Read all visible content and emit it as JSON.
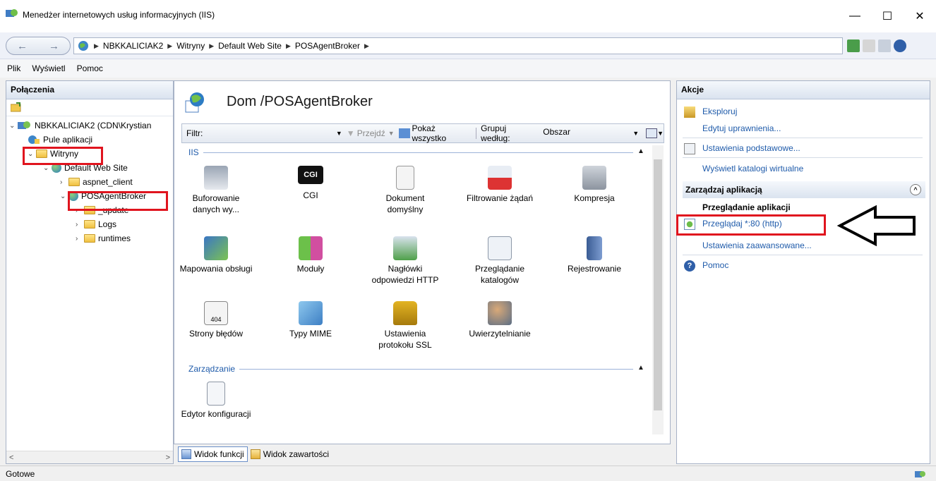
{
  "window": {
    "title": "Menedżer internetowych usług informacyjnych (IIS)",
    "minimize": "—",
    "maximize": "☐",
    "close": "✕"
  },
  "address": {
    "back": "←",
    "forward": "→",
    "crumbs": [
      "NBKKALICIAK2",
      "Witryny",
      "Default Web Site",
      "POSAgentBroker"
    ],
    "separator": "▶"
  },
  "menu": [
    "Plik",
    "Wyświetl",
    "Pomoc"
  ],
  "connections": {
    "header": "Połączenia",
    "tree": {
      "server": "NBKKALICIAK2 (CDN\\Krystian",
      "app_pools": "Pule aplikacji",
      "sites": "Witryny",
      "default_site": "Default Web Site",
      "aspnet_client": "aspnet_client",
      "pos": "POSAgentBroker",
      "update": "_update",
      "logs": "Logs",
      "runtimes": "runtimes"
    },
    "scroll_left": "<",
    "scroll_right": ">"
  },
  "center": {
    "title": "Dom /POSAgentBroker",
    "filter": {
      "label": "Filtr:",
      "go": "Przejdź",
      "show_all": "Pokaż wszystko",
      "group_by": "Grupuj według:",
      "group_value": "Obszar"
    },
    "sections": {
      "iis": "IIS",
      "management": "Zarządzanie"
    },
    "features": [
      {
        "l1": "Buforowanie",
        "l2": "danych wy..."
      },
      {
        "l1": "CGI",
        "l2": ""
      },
      {
        "l1": "Dokument",
        "l2": "domyślny"
      },
      {
        "l1": "Filtrowanie żądań",
        "l2": ""
      },
      {
        "l1": "Kompresja",
        "l2": ""
      },
      {
        "l1": "Mapowania obsługi",
        "l2": ""
      },
      {
        "l1": "Moduły",
        "l2": ""
      },
      {
        "l1": "Nagłówki",
        "l2": "odpowiedzi HTTP"
      },
      {
        "l1": "Przeglądanie",
        "l2": "katalogów"
      },
      {
        "l1": "Rejestrowanie",
        "l2": ""
      },
      {
        "l1": "Strony błędów",
        "l2": ""
      },
      {
        "l1": "Typy MIME",
        "l2": ""
      },
      {
        "l1": "Ustawienia",
        "l2": "protokołu SSL"
      },
      {
        "l1": "Uwierzytelnianie",
        "l2": ""
      }
    ],
    "mgmt_features": [
      {
        "l1": "Edytor konfiguracji"
      }
    ],
    "cgi_icon_text": "CGI",
    "err_icon_text": "404",
    "view_tabs": [
      "Widok funkcji",
      "Widok zawartości"
    ]
  },
  "actions": {
    "header": "Akcje",
    "explore": "Eksploruj",
    "edit_perms": "Edytuj uprawnienia...",
    "basic_settings": "Ustawienia podstawowe...",
    "virtual_dirs": "Wyświetl katalogi wirtualne",
    "manage_app": "Zarządzaj aplikacją",
    "browse_header": "Przeglądanie aplikacji",
    "browse_link": "Przeglądaj *:80 (http)",
    "advanced": "Ustawienia zaawansowane...",
    "help": "Pomoc",
    "collapse": "^"
  },
  "status": {
    "text": "Gotowe"
  },
  "colors": {
    "highlight": "#e0141e",
    "link": "#1f5baa"
  }
}
